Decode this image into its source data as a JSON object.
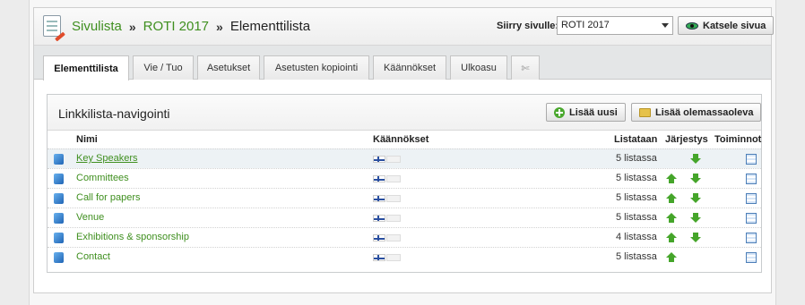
{
  "breadcrumb": {
    "root": "Sivulista",
    "site": "ROTI 2017",
    "current": "Elementtilista"
  },
  "goto": {
    "label": "Siirry sivulle:",
    "selected": "ROTI 2017"
  },
  "view_button": "Katsele sivua",
  "tabs": [
    {
      "label": "Elementtilista",
      "active": true
    },
    {
      "label": "Vie / Tuo"
    },
    {
      "label": "Asetukset"
    },
    {
      "label": "Asetusten kopiointi"
    },
    {
      "label": "Käännökset"
    },
    {
      "label": "Ulkoasu"
    },
    {
      "label": "✄"
    }
  ],
  "content": {
    "title": "Linkkilista-navigointi",
    "add_new": "Lisää uusi",
    "add_existing": "Lisää olemassaoleva",
    "columns": {
      "name": "Nimi",
      "translations": "Käännökset",
      "listed": "Listataan",
      "order": "Järjestys",
      "actions": "Toiminnot"
    },
    "rows": [
      {
        "name": "Key Speakers",
        "count": "5 listassa",
        "up": false,
        "down": true
      },
      {
        "name": "Committees",
        "count": "5 listassa",
        "up": true,
        "down": true
      },
      {
        "name": "Call for papers",
        "count": "5 listassa",
        "up": true,
        "down": true
      },
      {
        "name": "Venue",
        "count": "5 listassa",
        "up": true,
        "down": true
      },
      {
        "name": "Exhibitions & sponsorship",
        "count": "4 listassa",
        "up": true,
        "down": true
      },
      {
        "name": "Contact",
        "count": "5 listassa",
        "up": true,
        "down": false
      }
    ]
  },
  "colors": {
    "link_green": "#3f8f1f",
    "row_highlight": "#edf2f5"
  }
}
